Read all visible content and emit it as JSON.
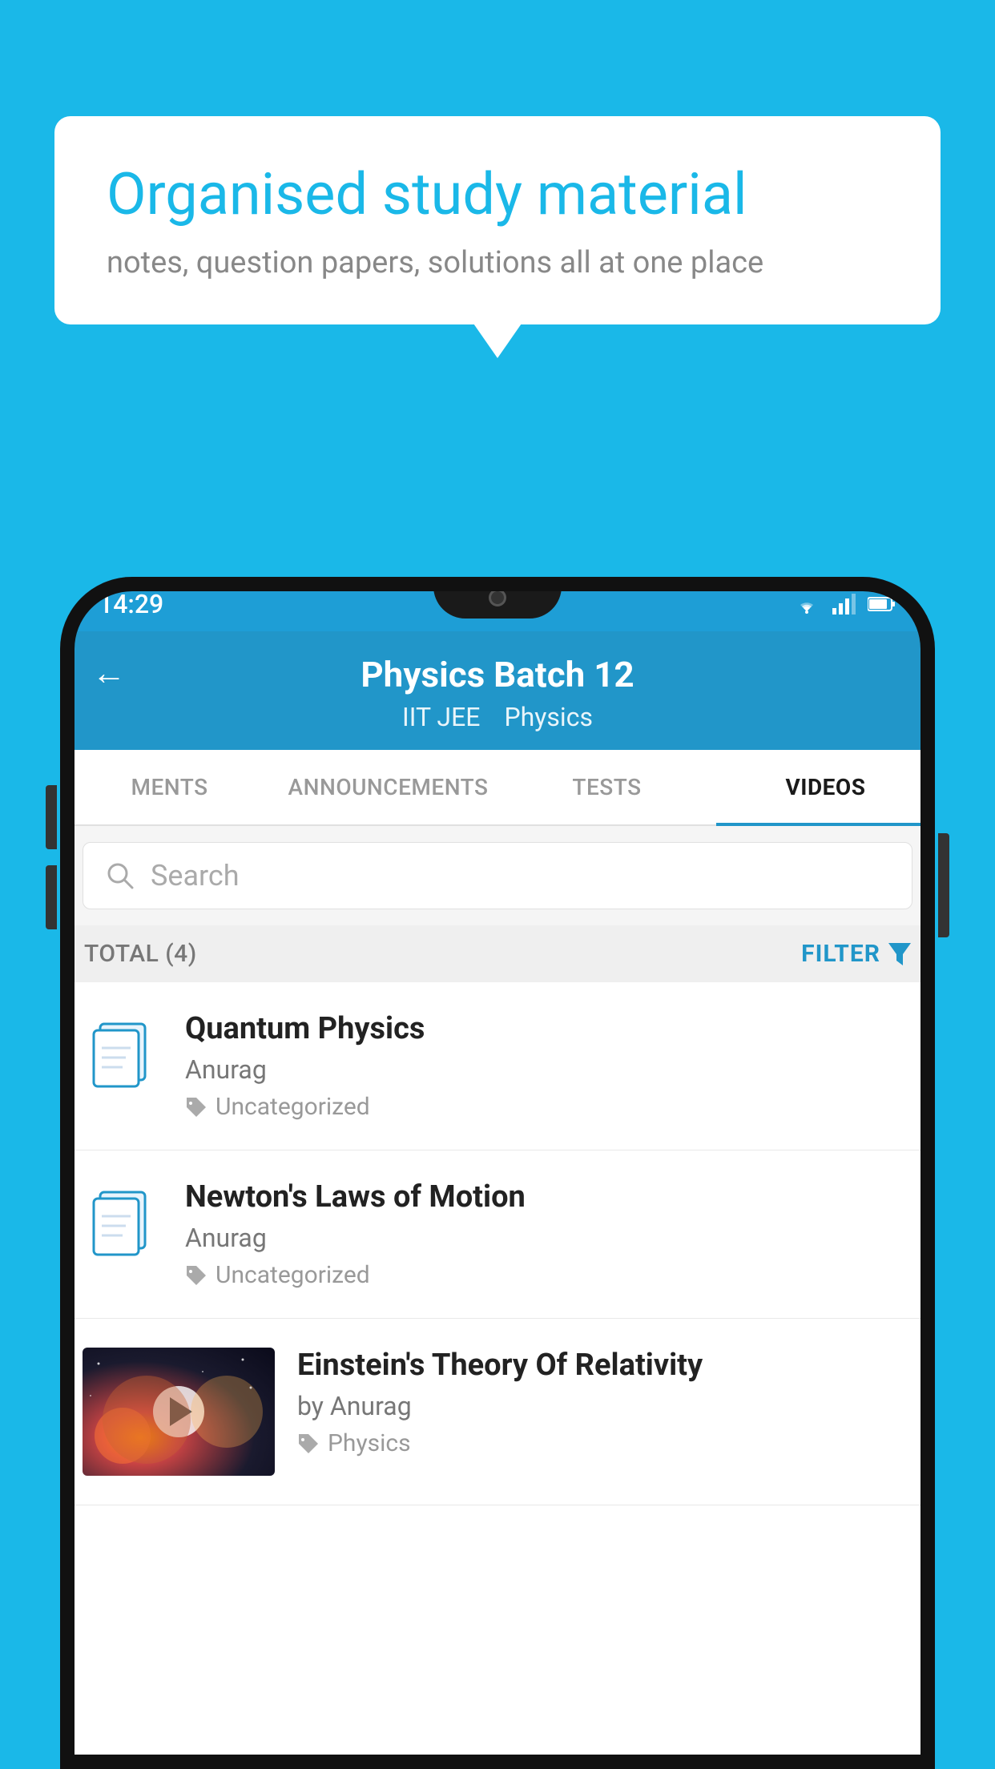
{
  "background_color": "#1ab8e8",
  "speech_bubble": {
    "title": "Organised study material",
    "subtitle": "notes, question papers, solutions all at one place"
  },
  "status_bar": {
    "time": "14:29",
    "wifi": "▼",
    "signal": "▲",
    "battery": "▮"
  },
  "app_header": {
    "back_label": "←",
    "title": "Physics Batch 12",
    "tag1": "IIT JEE",
    "tag2": "Physics"
  },
  "tabs": [
    {
      "label": "MENTS",
      "active": false
    },
    {
      "label": "ANNOUNCEMENTS",
      "active": false
    },
    {
      "label": "TESTS",
      "active": false
    },
    {
      "label": "VIDEOS",
      "active": true
    }
  ],
  "search": {
    "placeholder": "Search"
  },
  "filter_bar": {
    "total_label": "TOTAL (4)",
    "filter_label": "FILTER"
  },
  "video_items": [
    {
      "title": "Quantum Physics",
      "author": "Anurag",
      "tag": "Uncategorized",
      "has_thumbnail": false
    },
    {
      "title": "Newton's Laws of Motion",
      "author": "Anurag",
      "tag": "Uncategorized",
      "has_thumbnail": false
    },
    {
      "title": "Einstein's Theory Of Relativity",
      "author": "by Anurag",
      "tag": "Physics",
      "has_thumbnail": true
    }
  ]
}
